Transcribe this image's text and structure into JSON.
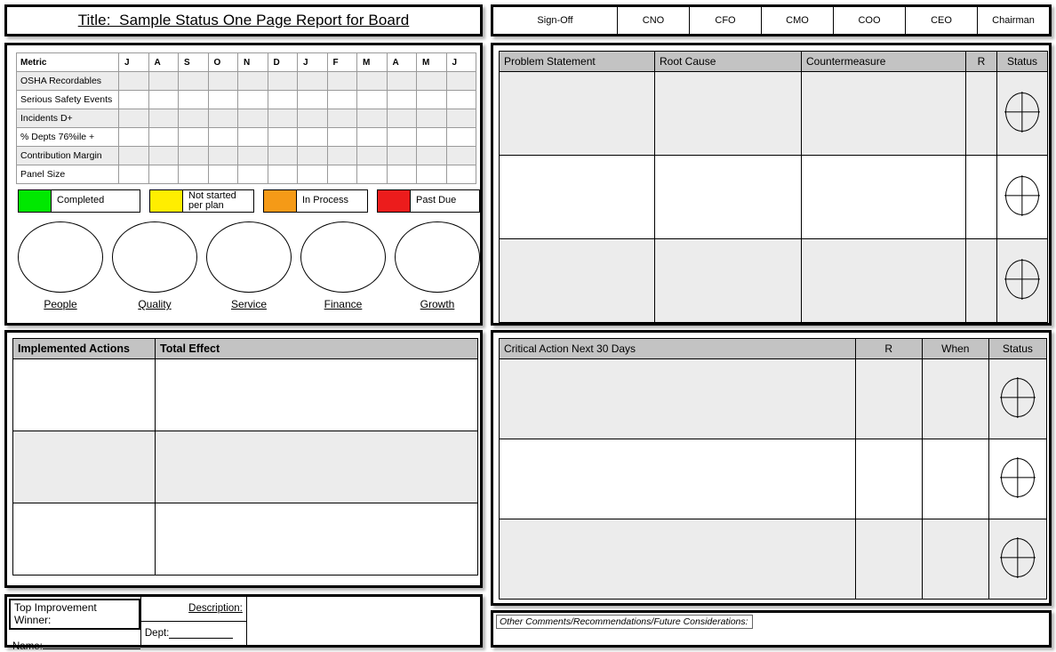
{
  "title": {
    "text": "Title:  Sample Status One Page Report for Board"
  },
  "metrics_table": {
    "header_metric": "Metric",
    "months": [
      "J",
      "A",
      "S",
      "O",
      "N",
      "D",
      "J",
      "F",
      "M",
      "A",
      "M",
      "J"
    ],
    "rows": [
      {
        "label": "OSHA Recordables"
      },
      {
        "label": "Serious Safety Events"
      },
      {
        "label": "Incidents D+"
      },
      {
        "label": "% Depts 76%ile +"
      },
      {
        "label": "Contribution Margin"
      },
      {
        "label": "Panel Size"
      }
    ]
  },
  "legend": {
    "items": [
      {
        "label": "Completed",
        "color": "#00e800"
      },
      {
        "label": "Not started\nper plan",
        "color": "#ffee00"
      },
      {
        "label": "In Process",
        "color": "#f59a17"
      },
      {
        "label": "Past Due",
        "color": "#ec1c1c"
      }
    ]
  },
  "pillars": {
    "items": [
      {
        "label": "People"
      },
      {
        "label": "Quality"
      },
      {
        "label": "Service"
      },
      {
        "label": "Finance"
      },
      {
        "label": "Growth"
      }
    ]
  },
  "signoff": {
    "label": "Sign-Off",
    "roles": [
      "CNO",
      "CFO",
      "CMO",
      "COO",
      "CEO",
      "Chairman"
    ]
  },
  "problem_table": {
    "headers": [
      "Problem Statement",
      "Root Cause",
      "Countermeasure",
      "R",
      "Status"
    ],
    "rows": [
      {
        "problem": "",
        "root_cause": "",
        "countermeasure": "",
        "r": "",
        "status": "status-circle-icon"
      },
      {
        "problem": "",
        "root_cause": "",
        "countermeasure": "",
        "r": "",
        "status": "status-circle-icon"
      },
      {
        "problem": "",
        "root_cause": "",
        "countermeasure": "",
        "r": "",
        "status": "status-circle-icon"
      }
    ]
  },
  "actions_table": {
    "headers": [
      "Implemented Actions",
      "Total Effect"
    ],
    "rows": [
      {
        "action": "",
        "effect": ""
      },
      {
        "action": "",
        "effect": ""
      },
      {
        "action": "",
        "effect": ""
      }
    ]
  },
  "critical_table": {
    "headers": [
      "Critical Action Next 30 Days",
      "R",
      "When",
      "Status"
    ],
    "rows": [
      {
        "action": "",
        "r": "",
        "when": "",
        "status": "status-circle-icon"
      },
      {
        "action": "",
        "r": "",
        "when": "",
        "status": "status-circle-icon"
      },
      {
        "action": "",
        "r": "",
        "when": "",
        "status": "status-circle-icon"
      }
    ]
  },
  "winner": {
    "title": "Top Improvement Winner:",
    "name_label": "Name:",
    "name_value": "",
    "description_label": "Description:",
    "description_value": "",
    "dept_label": "Dept:",
    "dept_value": ""
  },
  "comments": {
    "label": "Other Comments/Recommendations/Future Considerations:",
    "value": ""
  }
}
